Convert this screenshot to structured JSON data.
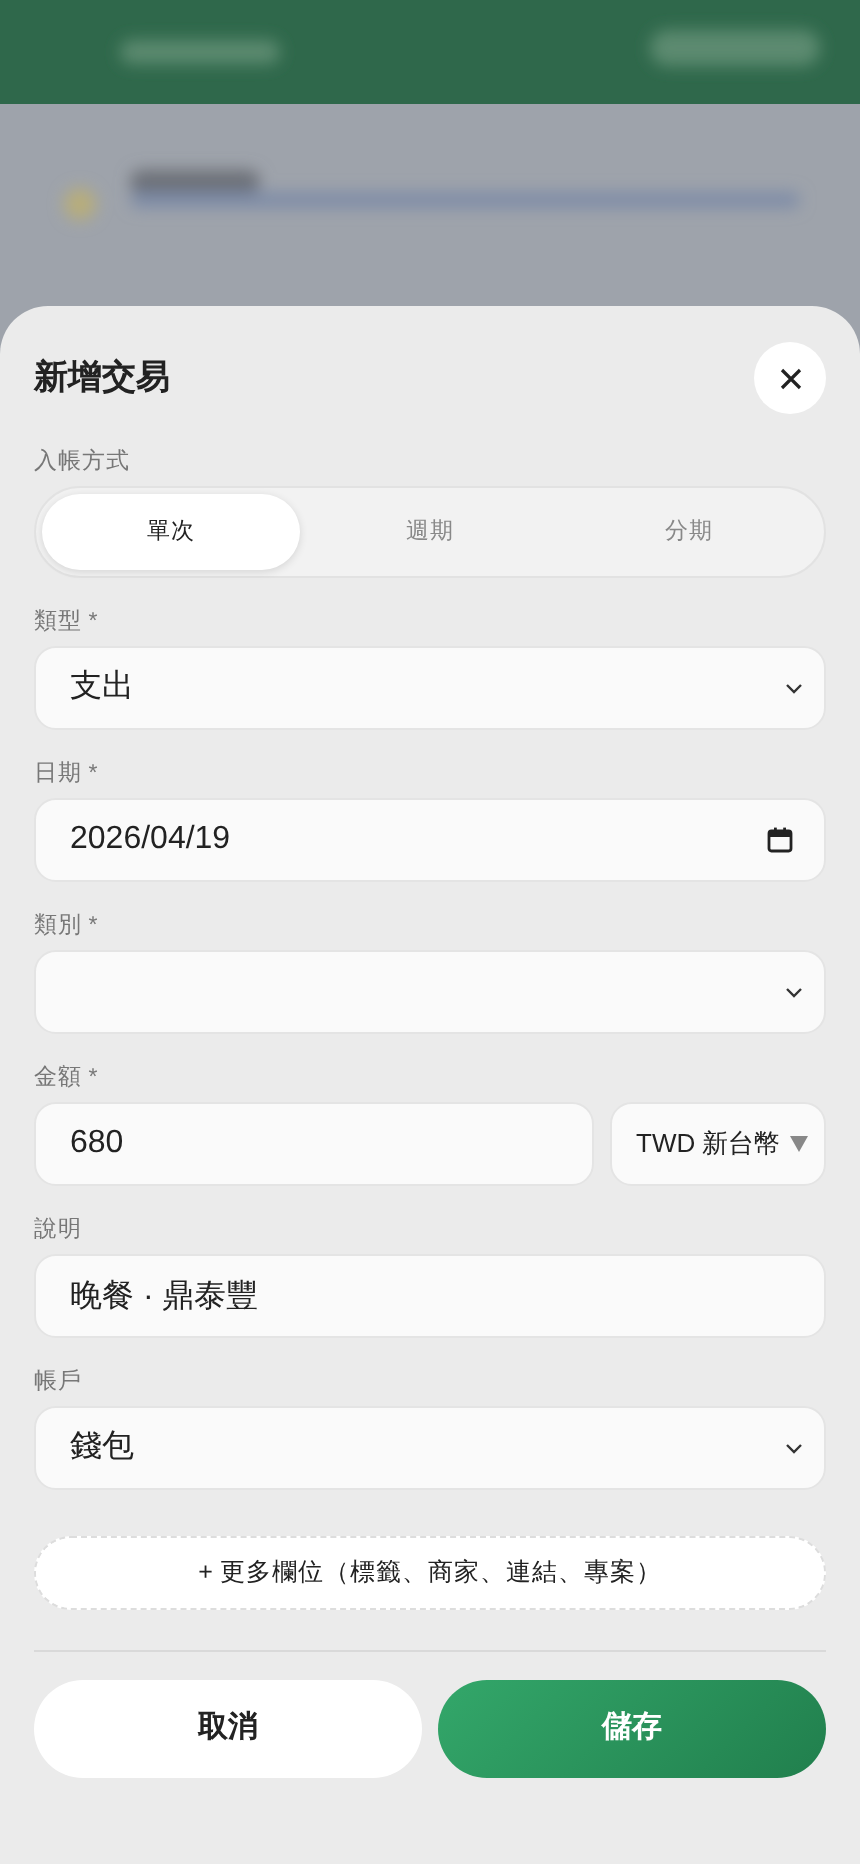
{
  "title": "新增交易",
  "entry_mode": {
    "label": "入帳方式",
    "options": [
      {
        "label": "單次",
        "selected": true
      },
      {
        "label": "週期",
        "selected": false
      },
      {
        "label": "分期",
        "selected": false
      }
    ]
  },
  "fields": [
    {
      "kind": "select",
      "label": "類型 *",
      "value": "支出"
    },
    {
      "kind": "date",
      "label": "日期 *",
      "value": "2026/04/19"
    },
    {
      "kind": "select",
      "label": "類別 *"
    },
    {
      "kind": "amount",
      "label": "金額 *",
      "value": "680",
      "currency": "TWD 新台幣"
    },
    {
      "kind": "text",
      "label": "說明",
      "value": "晚餐 · 鼎泰豐"
    },
    {
      "kind": "select",
      "label": "帳戶",
      "value": "錢包"
    }
  ],
  "more_fields_button": "+ 更多欄位（標籤、商家、連結、專案）",
  "buttons": [
    {
      "kind": "secondary",
      "label": "取消"
    },
    {
      "kind": "primary",
      "label": "儲存"
    }
  ]
}
